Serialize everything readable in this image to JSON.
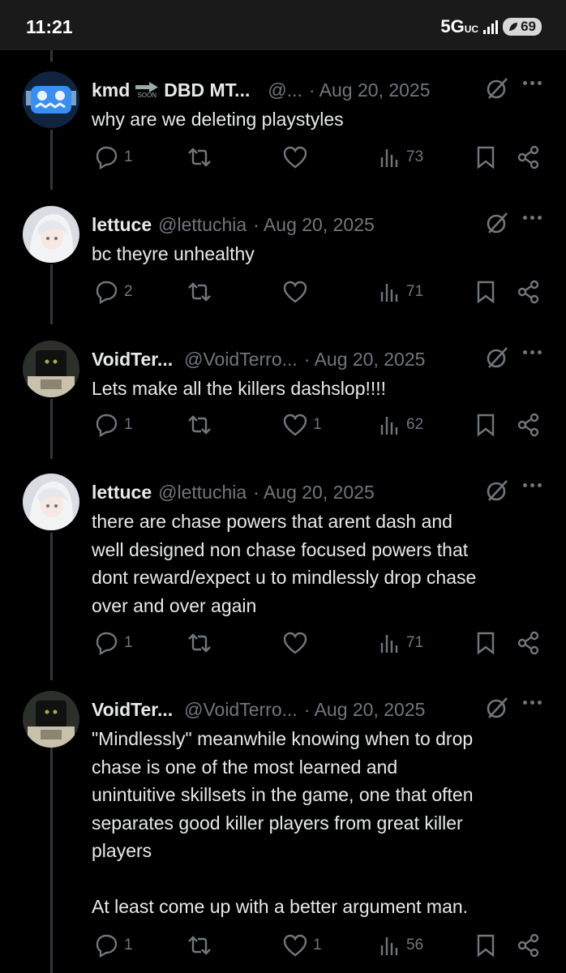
{
  "status": {
    "time": "11:21",
    "network": "5G",
    "network_sub": "UC",
    "battery": "69"
  },
  "soon_label": "SOON",
  "tweets": [
    {
      "name": "kmd",
      "name2": "DBD MT...",
      "handle": "@...",
      "date": "· Aug 20, 2025",
      "text": "why are we deleting playstyles",
      "replies": "1",
      "reposts": "",
      "likes": "",
      "views": "73"
    },
    {
      "name": "lettuce",
      "handle": "@lettuchia",
      "date": "· Aug 20, 2025",
      "text": "bc theyre unhealthy",
      "replies": "2",
      "reposts": "",
      "likes": "",
      "views": "71"
    },
    {
      "name": "VoidTer...",
      "handle": "@VoidTerro...",
      "date": "· Aug 20, 2025",
      "text": "Lets make all the killers dashslop!!!!",
      "replies": "1",
      "reposts": "",
      "likes": "1",
      "views": "62"
    },
    {
      "name": "lettuce",
      "handle": "@lettuchia",
      "date": "· Aug 20, 2025",
      "text": "there are chase powers that arent dash and\nwell designed non chase focused powers that\ndont reward/expect u to mindlessly drop chase\nover and over again",
      "replies": "1",
      "reposts": "",
      "likes": "",
      "views": "71"
    },
    {
      "name": "VoidTer...",
      "handle": "@VoidTerro...",
      "date": "· Aug 20, 2025",
      "text": "\"Mindlessly\" meanwhile knowing when to drop\nchase is one of the most learned and\nunintuitive skillsets in the game, one that often\nseparates good killer players from great killer\nplayers\n\nAt least come up with a better argument man.",
      "replies": "1",
      "reposts": "",
      "likes": "1",
      "views": "56"
    }
  ],
  "icons": [
    "reply-icon",
    "repost-icon",
    "like-icon",
    "views-icon",
    "bookmark-icon",
    "share-icon",
    "grok-icon",
    "more-icon"
  ]
}
